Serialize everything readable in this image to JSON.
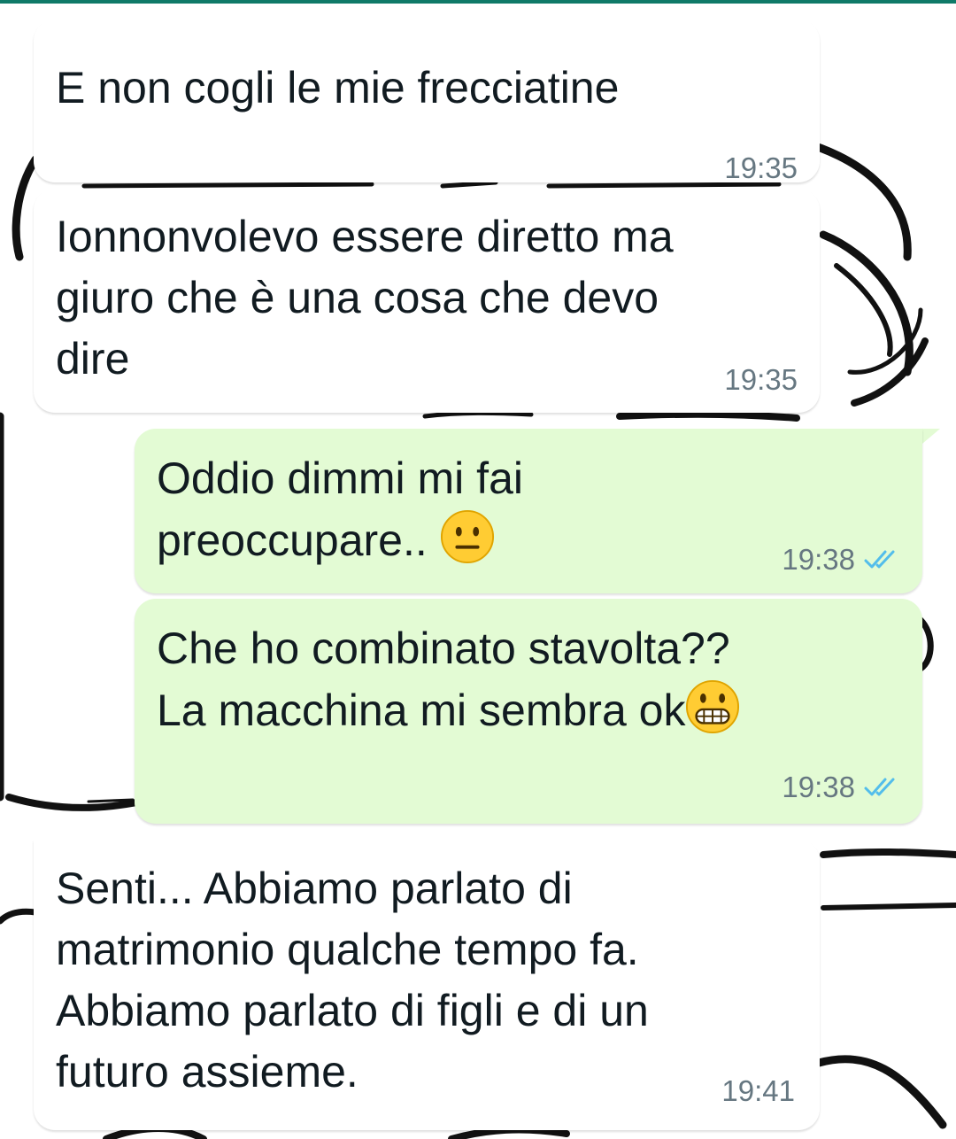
{
  "chat": {
    "messages": [
      {
        "direction": "incoming",
        "lines": [
          "E non cogli le mie frecciatine"
        ],
        "time": "19:35"
      },
      {
        "direction": "incoming",
        "lines": [
          "Ionnonvolevo essere diretto ma",
          "giuro che è una cosa che devo",
          "dire"
        ],
        "time": "19:35"
      },
      {
        "direction": "outgoing",
        "lines": [
          "Oddio dimmi mi fai",
          "preoccupare.."
        ],
        "emoji": "neutral-face-emoji",
        "time": "19:38",
        "status": "read-double-check-icon"
      },
      {
        "direction": "outgoing",
        "lines": [
          "Che ho combinato stavolta??",
          "La macchina mi sembra ok"
        ],
        "emoji": "grimacing-face-emoji",
        "time": "19:38",
        "status": "read-double-check-icon"
      },
      {
        "direction": "incoming",
        "lines": [
          "Senti... Abbiamo parlato di",
          "matrimonio qualche tempo fa.",
          "Abbiamo parlato di figli e di un",
          "futuro assieme."
        ],
        "time": "19:41"
      }
    ]
  },
  "colors": {
    "incoming_bubble": "#ffffff",
    "outgoing_bubble": "#e3fbd4",
    "read_ticks": "#53bdeb",
    "timestamp": "#667781",
    "header_strip": "#0f7a68"
  }
}
